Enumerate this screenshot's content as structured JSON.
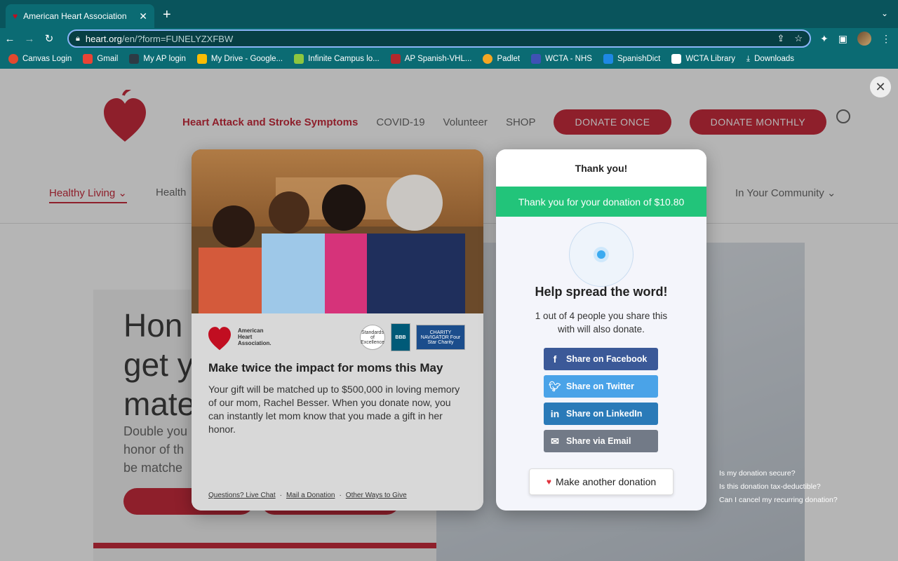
{
  "browser": {
    "tab_title": "American Heart Association | T",
    "tab_close": "✕",
    "new_tab": "+",
    "url_host": "heart.org",
    "url_path": "/en/?form=FUNELYZXFBW",
    "bookmarks": [
      {
        "label": "Canvas Login",
        "color": "#e2492f"
      },
      {
        "label": "Gmail",
        "color": "#ea4335"
      },
      {
        "label": "My AP login",
        "color": "#2d3b45"
      },
      {
        "label": "My Drive - Google...",
        "color": "#fbbc04"
      },
      {
        "label": "Infinite Campus lo...",
        "color": "#8dc63f"
      },
      {
        "label": "AP Spanish-VHL...",
        "color": "#b3282d"
      },
      {
        "label": "Padlet",
        "color": "#f5a623"
      },
      {
        "label": "WCTA - NHS",
        "color": "#3f51b5"
      },
      {
        "label": "SpanishDict",
        "color": "#1e88e5"
      },
      {
        "label": "WCTA Library",
        "color": "#ffffff"
      },
      {
        "label": "Downloads",
        "color": "#0b6b73"
      }
    ]
  },
  "site": {
    "nav": [
      "Heart Attack and Stroke Symptoms",
      "COVID-19",
      "Volunteer",
      "SHOP"
    ],
    "donate_once": "DONATE ONCE",
    "donate_monthly": "DONATE MONTHLY",
    "subnav_active": "Healthy Living ⌄",
    "subnav_2": "Health",
    "subnav_3": "In Your Community ⌄",
    "hero_heading": "Hon\nget y\nmate",
    "hero_text": "Double you\nhonor of th\nbe matche"
  },
  "modal_left": {
    "org_name": "American Heart Association.",
    "badge_1": "Standards of Excellence",
    "badge_2": "BBB",
    "badge_3": "CHARITY NAVIGATOR Four Star Charity",
    "title": "Make twice the impact for moms this May",
    "body": "Your gift will be matched up to $500,000 in loving memory of our mom, Rachel Besser. When you donate now, you can instantly let mom know that you made a gift in her honor.",
    "links": [
      "Questions? Live Chat",
      "Mail a Donation",
      "Other Ways to Give"
    ],
    "sep": "·"
  },
  "modal_right": {
    "header": "Thank you!",
    "banner": "Thank you for your donation of $10.80",
    "heading": "Help spread the word!",
    "subtext": "1 out of 4 people you share this with will also donate.",
    "share_facebook": "Share on Facebook",
    "share_twitter": "Share on Twitter",
    "share_linkedin": "Share on LinkedIn",
    "share_email": "Share via Email",
    "make_another": "Make another donation"
  },
  "faq": [
    "Is my donation secure?",
    "Is this donation tax-deductible?",
    "Can I cancel my recurring donation?"
  ],
  "close_symbol": "✕"
}
